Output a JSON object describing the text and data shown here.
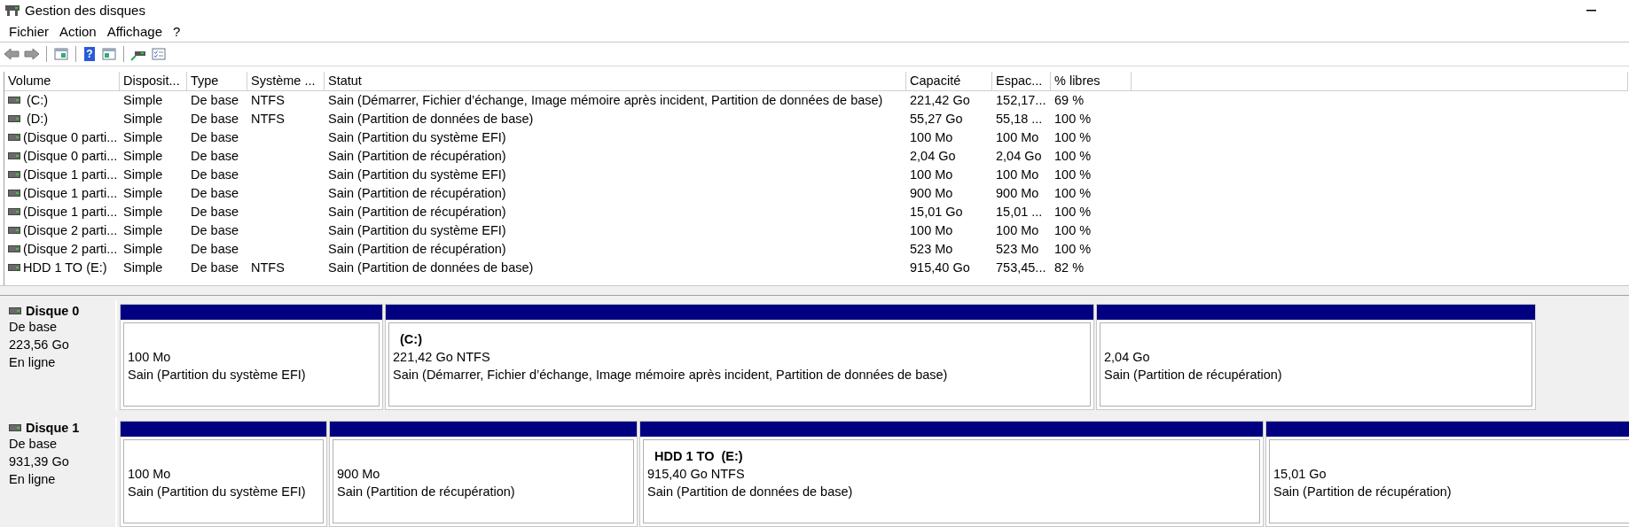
{
  "window": {
    "title": "Gestion des disques"
  },
  "menu": [
    "Fichier",
    "Action",
    "Affichage",
    "?"
  ],
  "toolbar": {
    "help_glyph": "?"
  },
  "table": {
    "columns": [
      "Volume",
      "Disposit...",
      "Type",
      "Système ...",
      "Statut",
      "Capacité",
      "Espac...",
      "% libres"
    ],
    "rows": [
      {
        "cells": [
          " (C:)",
          "Simple",
          "De base",
          "NTFS",
          "Sain (Démarrer, Fichier d’échange, Image mémoire après incident, Partition de données de base)",
          "221,42 Go",
          "152,17...",
          "69 %"
        ]
      },
      {
        "cells": [
          " (D:)",
          "Simple",
          "De base",
          "NTFS",
          "Sain (Partition de données de base)",
          "55,27 Go",
          "55,18 ...",
          "100 %"
        ]
      },
      {
        "cells": [
          "(Disque 0 parti...",
          "Simple",
          "De base",
          "",
          "Sain (Partition du système EFI)",
          "100 Mo",
          "100 Mo",
          "100 %"
        ]
      },
      {
        "cells": [
          "(Disque 0 parti...",
          "Simple",
          "De base",
          "",
          "Sain (Partition de récupération)",
          "2,04 Go",
          "2,04 Go",
          "100 %"
        ]
      },
      {
        "cells": [
          "(Disque 1 parti...",
          "Simple",
          "De base",
          "",
          "Sain (Partition du système EFI)",
          "100 Mo",
          "100 Mo",
          "100 %"
        ]
      },
      {
        "cells": [
          "(Disque 1 parti...",
          "Simple",
          "De base",
          "",
          "Sain (Partition de récupération)",
          "900 Mo",
          "900 Mo",
          "100 %"
        ]
      },
      {
        "cells": [
          "(Disque 1 parti...",
          "Simple",
          "De base",
          "",
          "Sain (Partition de récupération)",
          "15,01 Go",
          "15,01 ...",
          "100 %"
        ]
      },
      {
        "cells": [
          "(Disque 2 parti...",
          "Simple",
          "De base",
          "",
          "Sain (Partition du système EFI)",
          "100 Mo",
          "100 Mo",
          "100 %"
        ]
      },
      {
        "cells": [
          "(Disque 2 parti...",
          "Simple",
          "De base",
          "",
          "Sain (Partition de récupération)",
          "523 Mo",
          "523 Mo",
          "100 %"
        ]
      },
      {
        "cells": [
          "HDD 1 TO (E:)",
          "Simple",
          "De base",
          "NTFS",
          "Sain (Partition de données de base)",
          "915,40 Go",
          "753,45...",
          "82 %"
        ]
      }
    ]
  },
  "disks": [
    {
      "name": "Disque 0",
      "type": "De base",
      "size": "223,56 Go",
      "status": "En ligne",
      "partitions": [
        {
          "size": "100 Mo",
          "status": "Sain (Partition du système EFI)"
        },
        {
          "label": "(C:)",
          "size": "221,42 Go NTFS",
          "status": "Sain (Démarrer, Fichier d’échange, Image mémoire après incident, Partition de données de base)"
        },
        {
          "size": "2,04 Go",
          "status": "Sain (Partition de récupération)"
        }
      ]
    },
    {
      "name": "Disque 1",
      "type": "De base",
      "size": "931,39 Go",
      "status": "En ligne",
      "partitions": [
        {
          "size": "100 Mo",
          "status": "Sain (Partition du système EFI)"
        },
        {
          "size": "900 Mo",
          "status": "Sain (Partition de récupération)"
        },
        {
          "label": "HDD 1 TO  (E:)",
          "size": "915,40 Go NTFS",
          "status": "Sain (Partition de données de base)"
        },
        {
          "size": "15,01 Go",
          "status": "Sain (Partition de récupération)"
        }
      ]
    }
  ]
}
